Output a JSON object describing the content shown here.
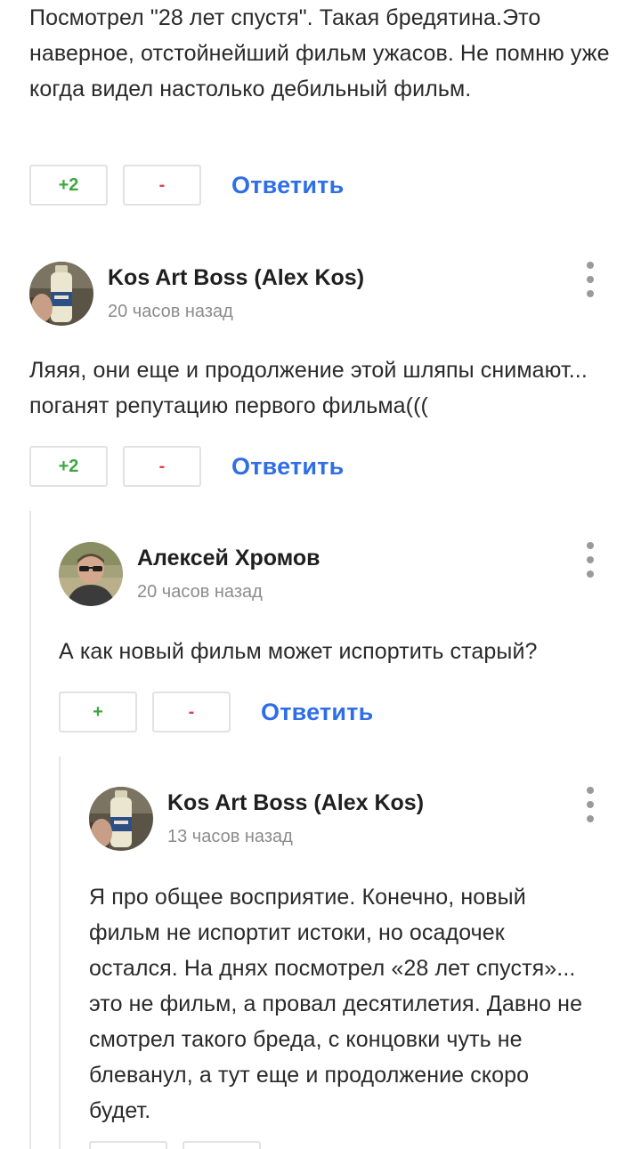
{
  "comment0": {
    "text": "Посмотрел \"28 лет спустя\". Такая бредятина.Это наверное, отстойнейший фильм ужасов. Не помню уже когда видел настолько дебильный фильм.",
    "plus_label": "+2",
    "minus_label": "-",
    "reply_label": "Ответить"
  },
  "comment1": {
    "author": "Kos Art Boss (Alex Kos)",
    "time": "20 часов назад",
    "text": "Ляяя, они еще и продолжение этой шляпы снимают... поганят репутацию первого фильма(((",
    "plus_label": "+2",
    "minus_label": "-",
    "reply_label": "Ответить"
  },
  "comment2": {
    "author": "Алексей Хромов",
    "time": "20 часов назад",
    "text": "А как новый фильм может испортить старый?",
    "plus_label": "+",
    "minus_label": "-",
    "reply_label": "Ответить"
  },
  "comment3": {
    "author": "Kos Art Boss (Alex Kos)",
    "time": "13 часов назад",
    "text": "Я про общее восприятие. Конечно, новый фильм не испортит истоки, но осадочек остался. На днях посмотрел «28 лет спустя»... это не фильм, а провал десятилетия. Давно не смотрел такого бреда, с концовки чуть не блеванул, а тут еще и продолжение скоро будет."
  },
  "icons": {
    "more": "more-vertical-icon",
    "avatar_kos": "bottle-avatar",
    "avatar_alexey": "man-sunglasses-avatar"
  },
  "colors": {
    "plus": "#3fa63f",
    "minus": "#e5414c",
    "reply": "#2f6ee5",
    "time": "#8c8c8c"
  }
}
